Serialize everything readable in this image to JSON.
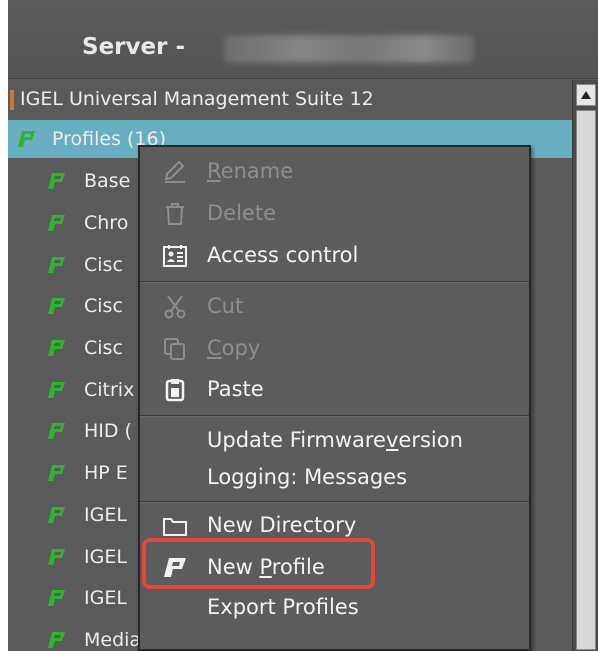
{
  "header": {
    "title": "Server -"
  },
  "tree": {
    "root": "IGEL Universal Management Suite 12",
    "profiles": "Profiles (16)",
    "items": [
      {
        "label": "Base"
      },
      {
        "label": "Chro"
      },
      {
        "label": "Cisc"
      },
      {
        "label": "Cisc"
      },
      {
        "label": "Cisc"
      },
      {
        "label": "Citrix"
      },
      {
        "label": "HID ("
      },
      {
        "label": "HP E"
      },
      {
        "label": "IGEL"
      },
      {
        "label": "IGEL"
      },
      {
        "label": "IGEL"
      },
      {
        "label": "Media Player (Parole)"
      }
    ]
  },
  "menu": {
    "rename": {
      "pre": "",
      "u": "R",
      "post": "ename"
    },
    "delete": "Delete",
    "access_control": "Access control",
    "cut": "Cut",
    "copy": {
      "pre": "",
      "u": "C",
      "post": "opy"
    },
    "paste": "Paste",
    "update_firmware": {
      "pre": "Update Firmware",
      "u": "v",
      "post": "ersion"
    },
    "logging": "Logging: Messages",
    "new_directory": "New Directory",
    "new_profile": {
      "pre": "New ",
      "u": "P",
      "post": "rofile"
    },
    "export_profiles": "Export Profiles"
  },
  "colors": {
    "selection": "#6aaec2",
    "profile_icon": "#2db52d",
    "highlight_box": "#e8453c"
  }
}
